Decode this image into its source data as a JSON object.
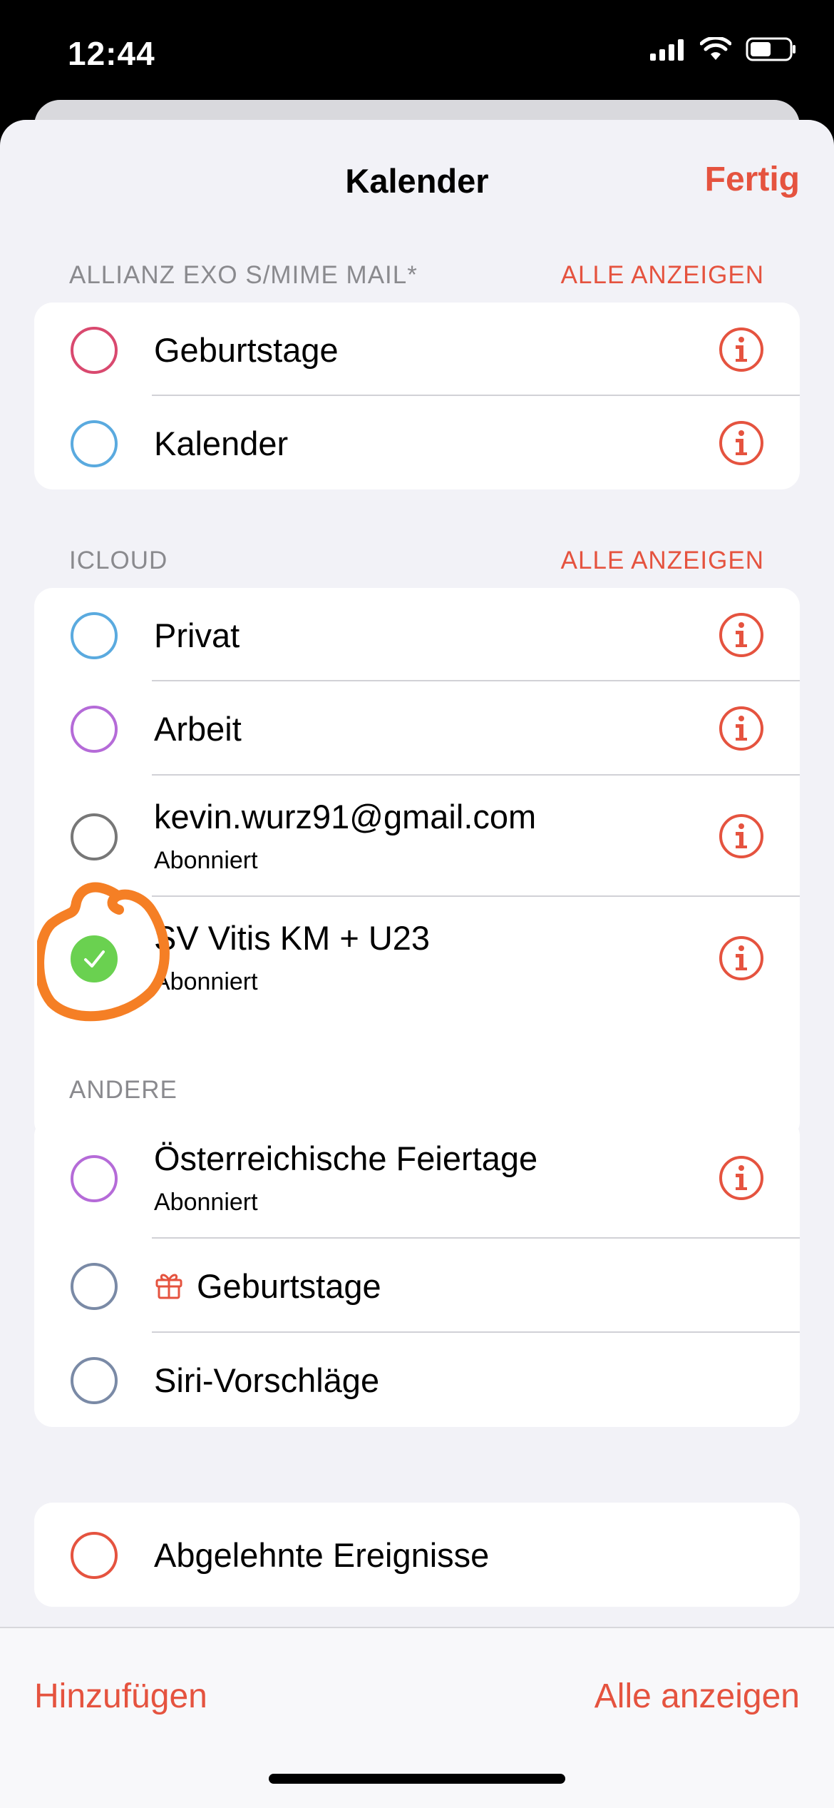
{
  "status": {
    "time": "12:44"
  },
  "nav": {
    "title": "Kalender",
    "done": "Fertig"
  },
  "sections": [
    {
      "header": "ALLIANZ EXO S/MIME MAIL*",
      "action": "ALLE ANZEIGEN"
    },
    {
      "header": "ICLOUD",
      "action": "ALLE ANZEIGEN"
    },
    {
      "header": "ANDERE"
    }
  ],
  "calendars": {
    "geburtstage1": {
      "label": "Geburtstage",
      "color": "#d9496f"
    },
    "kalender": {
      "label": "Kalender",
      "color": "#5aaadf"
    },
    "privat": {
      "label": "Privat",
      "color": "#5aaadf"
    },
    "arbeit": {
      "label": "Arbeit",
      "color": "#b56bd8"
    },
    "gmail": {
      "label": "kevin.wurz91@gmail.com",
      "sub": "Abonniert",
      "color": "#777777"
    },
    "svvitis": {
      "label": "SV Vitis KM + U23",
      "sub": "Abonniert",
      "color": "#6ad150",
      "checked": true
    },
    "feiertage": {
      "label": "Österreichische Feiertage",
      "sub": "Abonniert",
      "color": "#b56bd8"
    },
    "geburtstage2": {
      "label": "Geburtstage",
      "color": "#7a8aa6",
      "icon": "gift-icon"
    },
    "siri": {
      "label": "Siri-Vorschläge",
      "color": "#7a8aa6"
    },
    "abgelehnt": {
      "label": "Abgelehnte Ereignisse",
      "color": "#e5533f"
    }
  },
  "toolbar": {
    "add": "Hinzufügen",
    "show_all": "Alle anzeigen"
  },
  "colors": {
    "accent": "#e5533f",
    "annotation": "#f57f25"
  }
}
